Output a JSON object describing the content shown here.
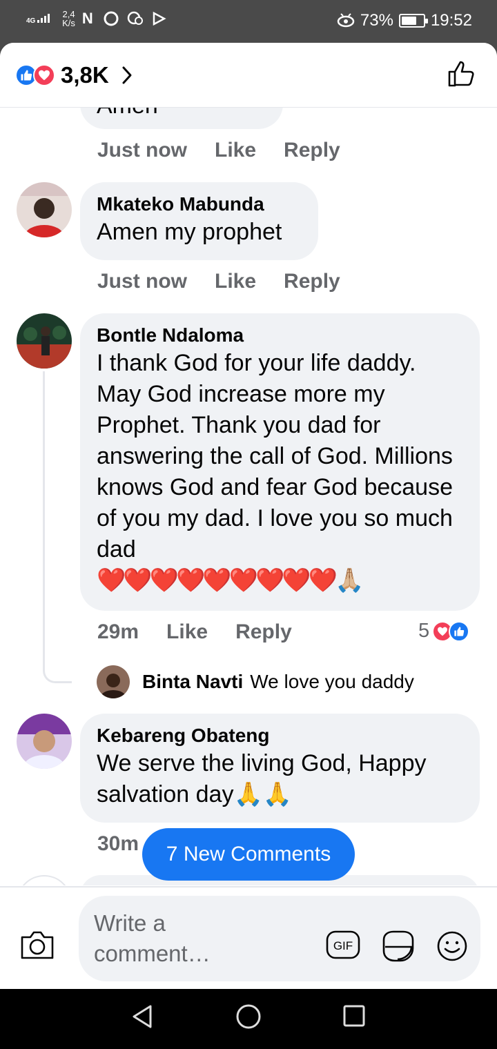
{
  "status_bar": {
    "network": "4G",
    "speed_value": "2,4",
    "speed_unit": "K/s",
    "indicator_icons": [
      "nfc-icon",
      "circle-icon",
      "chat-icon",
      "play-icon"
    ],
    "battery_percent": "73%",
    "battery_level": 0.73,
    "time": "19:52"
  },
  "header": {
    "reaction_count": "3,8K",
    "reaction_icons": [
      "like-icon",
      "love-icon"
    ]
  },
  "comments": [
    {
      "partial_text": "Amen",
      "time": "Just now",
      "like_label": "Like",
      "reply_label": "Reply"
    },
    {
      "author": "Mkateko Mabunda",
      "text": "Amen my prophet",
      "time": "Just now",
      "like_label": "Like",
      "reply_label": "Reply"
    },
    {
      "author": "Bontle Ndaloma",
      "text": "I thank God for your life daddy. May God increase more my Prophet. Thank you dad for answering the call of God. Millions knows God and fear God because of you my dad. I love you so much dad",
      "emojis": "❤️❤️❤️❤️❤️❤️❤️❤️❤️🙏🏼",
      "time": "29m",
      "like_label": "Like",
      "reply_label": "Reply",
      "reaction_count": "5",
      "reply": {
        "author": "Binta Navti",
        "text": "We love you daddy"
      }
    },
    {
      "author": "Kebareng Obateng",
      "text": "We serve the living God, Happy salvation day🙏🙏",
      "time": "30m"
    }
  ],
  "new_comments_label": "7 New Comments",
  "composer": {
    "placeholder": "Write a comment…",
    "gif_label": "GIF"
  },
  "colors": {
    "accent": "#1877f2",
    "love": "#f33e58",
    "bubble": "#f0f2f5",
    "meta": "#65676b"
  }
}
